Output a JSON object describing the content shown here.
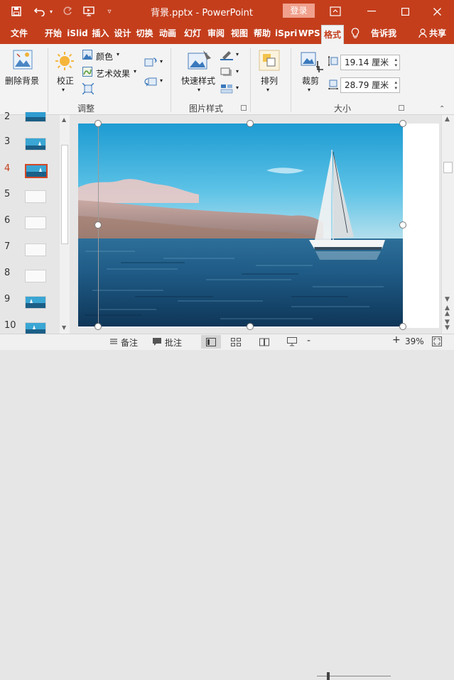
{
  "titlebar": {
    "document_title": "背景.pptx - PowerPoint",
    "login_label": "登录"
  },
  "tabs": [
    {
      "label": "文件"
    },
    {
      "label": "开始"
    },
    {
      "label": "iSlid"
    },
    {
      "label": "插入"
    },
    {
      "label": "设计"
    },
    {
      "label": "切换"
    },
    {
      "label": "动画"
    },
    {
      "label": "幻灯"
    },
    {
      "label": "审阅"
    },
    {
      "label": "视图"
    },
    {
      "label": "帮助"
    },
    {
      "label": "iSpri"
    },
    {
      "label": "WPS"
    },
    {
      "label": "格式"
    }
  ],
  "tellme": "告诉我",
  "share": "共享",
  "ribbon": {
    "remove_bg": "删除背景",
    "corrections": "校正",
    "color": "颜色",
    "artistic": "艺术效果",
    "group_adjust": "调整",
    "quick_styles": "快速样式",
    "group_styles": "图片样式",
    "arrange": "排列",
    "crop": "裁剪",
    "height_value": "19.14 厘米",
    "width_value": "28.79 厘米",
    "group_size": "大小"
  },
  "slides": {
    "numbers": [
      "2",
      "3",
      "4",
      "5",
      "6",
      "7",
      "8",
      "9",
      "10"
    ],
    "selected": "4"
  },
  "status": {
    "notes": "备注",
    "comments": "批注",
    "zoom_minus": "-",
    "zoom_plus": "+",
    "zoom_level": "39%"
  },
  "colors": {
    "accent": "#c43e1c",
    "selected_thumb_border": "#d24726"
  }
}
